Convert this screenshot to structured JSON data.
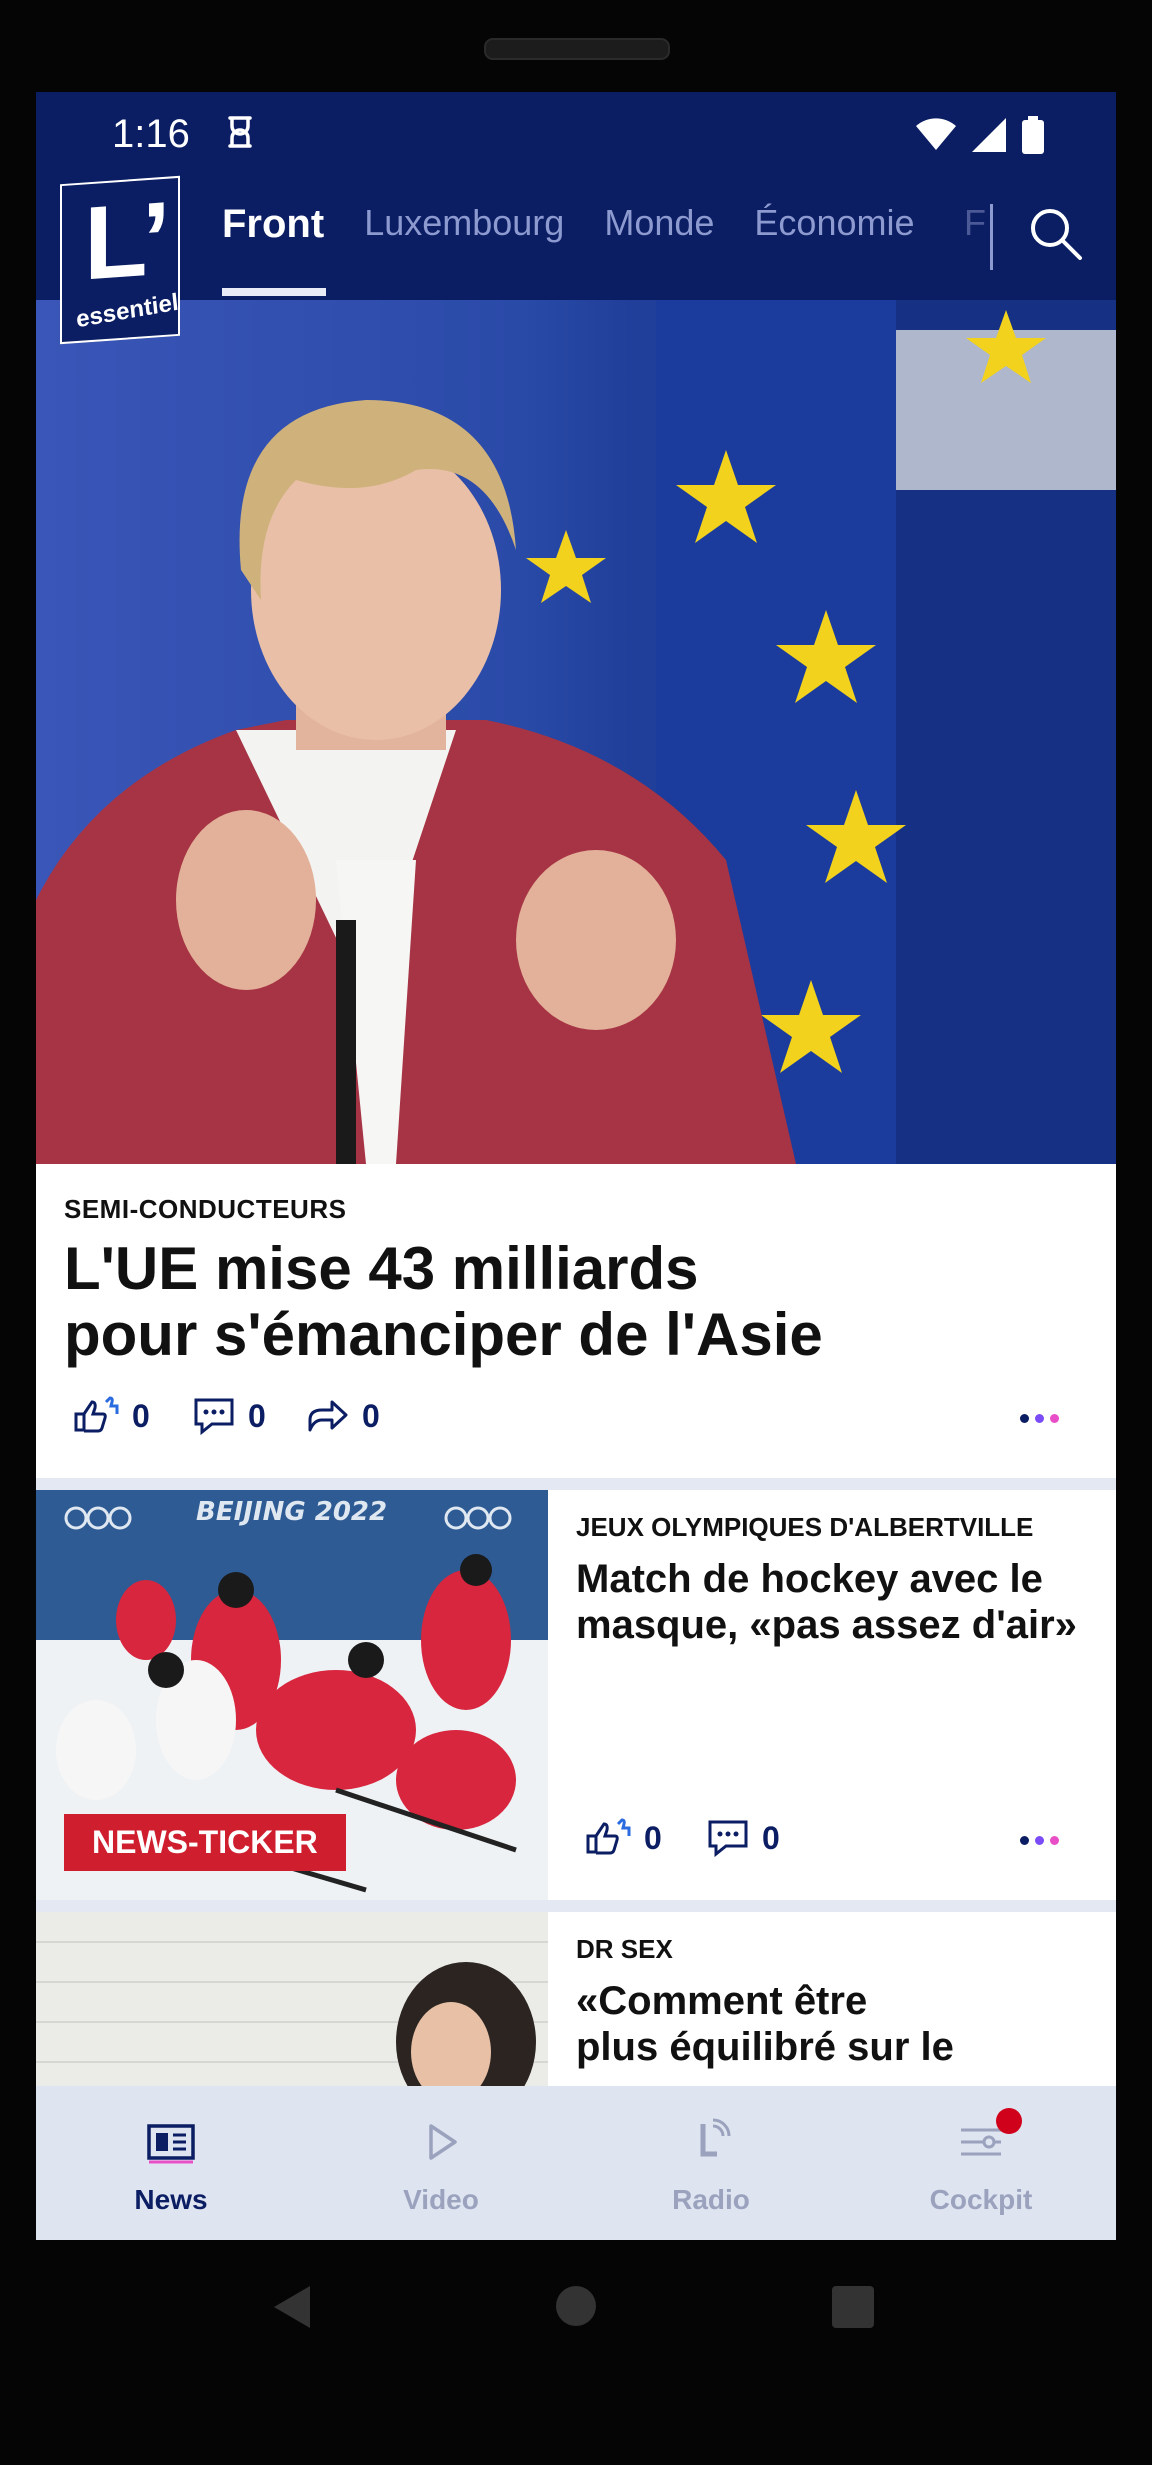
{
  "status_bar": {
    "time": "1:16"
  },
  "header": {
    "logo_text": "L’",
    "logo_subtext": "essentiel",
    "tabs": [
      {
        "label": "Front"
      },
      {
        "label": "Luxembourg"
      },
      {
        "label": "Monde"
      },
      {
        "label": "Économie"
      }
    ],
    "tab_partial": "F"
  },
  "articles": [
    {
      "kicker": "SEMI-CONDUCTEURS",
      "title_line1": "L'UE mise 43 milliards",
      "title_line2": "pour s'émanciper de l'Asie",
      "likes": "0",
      "comments": "0",
      "shares": "0"
    },
    {
      "kicker": "JEUX OLYMPIQUES D'ALBERTVILLE",
      "title_line1": "Match de hockey avec le",
      "title_line2": "masque, «pas assez d'air»",
      "badge": "NEWS-TICKER",
      "thumb_text": "BEIJING 2022",
      "likes": "0",
      "comments": "0"
    },
    {
      "kicker": "DR SEX",
      "title_line1": "«Comment être",
      "title_line2": "plus équilibré sur le"
    }
  ],
  "bottom_nav": [
    {
      "label": "News"
    },
    {
      "label": "Video"
    },
    {
      "label": "Radio"
    },
    {
      "label": "Cockpit"
    }
  ],
  "colors": {
    "brand": "#0b1d63",
    "accent_red": "#cf1f2e",
    "dot_purple": "#7b4cf5",
    "dot_pink": "#e84fc7"
  }
}
